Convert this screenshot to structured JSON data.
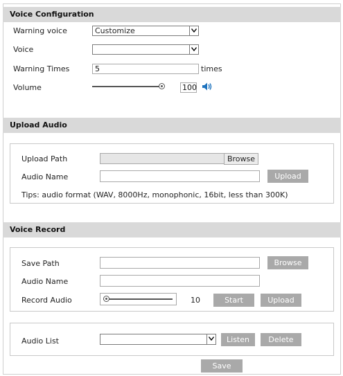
{
  "voice_config": {
    "title": "Voice Configuration",
    "warning_voice_label": "Warning voice",
    "warning_voice_value": "Customize",
    "voice_label": "Voice",
    "voice_value": "",
    "warning_times_label": "Warning Times",
    "warning_times_value": "5",
    "times_unit": "times",
    "volume_label": "Volume",
    "volume_value": "100",
    "volume_level_percent": 100
  },
  "upload_audio": {
    "title": "Upload Audio",
    "upload_path_label": "Upload Path",
    "upload_path_value": "",
    "browse_label": "Browse",
    "audio_name_label": "Audio Name",
    "audio_name_value": "",
    "upload_label": "Upload",
    "tips": "Tips: audio format (WAV, 8000Hz, monophonic, 16bit,  less than 300K)"
  },
  "voice_record": {
    "title": "Voice Record",
    "save_path_label": "Save Path",
    "save_path_value": "",
    "browse_label": "Browse",
    "audio_name_label": "Audio Name",
    "audio_name_value": "",
    "record_audio_label": "Record Audio",
    "record_value": "10",
    "record_level_percent": 0,
    "start_label": "Start",
    "upload_label": "Upload"
  },
  "audio_list": {
    "label": "Audio List",
    "value": "",
    "listen_label": "Listen",
    "delete_label": "Delete"
  },
  "footer": {
    "save_label": "Save"
  },
  "colors": {
    "header_bg": "#d9d9d9",
    "button_bg": "#a9a9a9",
    "speaker_blue": "#1e73be"
  }
}
